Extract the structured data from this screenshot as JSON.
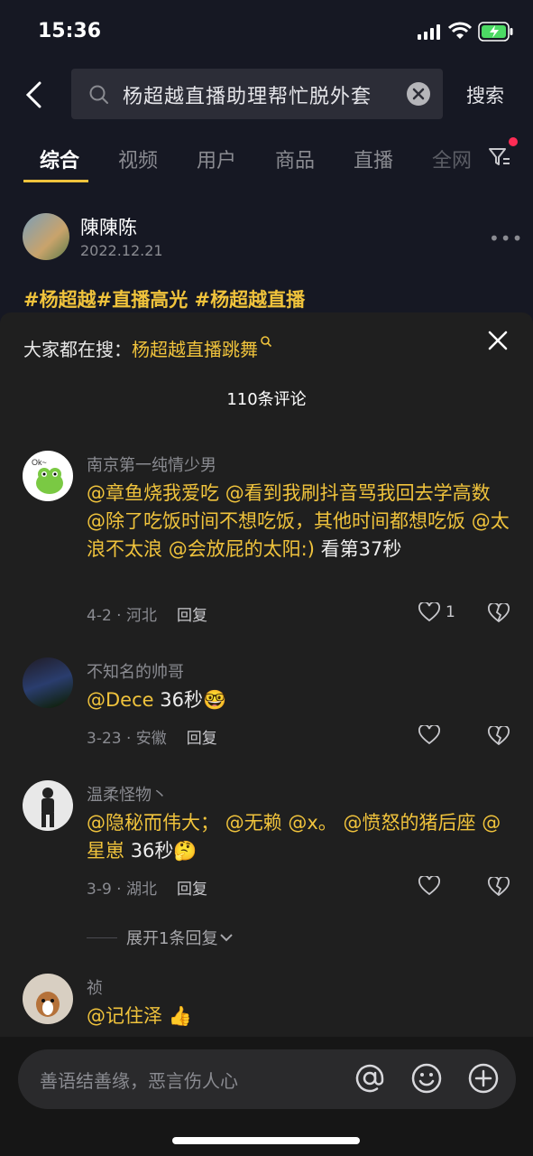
{
  "status": {
    "time": "15:36"
  },
  "search": {
    "query": "杨超越直播助理帮忙脱外套",
    "button": "搜索"
  },
  "tabs": [
    "综合",
    "视频",
    "用户",
    "商品",
    "直播",
    "全网"
  ],
  "post": {
    "author": "陳陳陈",
    "date": "2022.12.21",
    "tags": "#杨超越#直播高光  #杨超越直播"
  },
  "comments_panel": {
    "hot_label": "大家都在搜：",
    "hot_keyword": "杨超越直播跳舞",
    "count": "110条评论",
    "expand": "展开1条回复",
    "items": [
      {
        "name": "南京第一纯情少男",
        "mentions": [
          "@章鱼烧我爱吃",
          "@看到我刷抖音骂我回去学高数",
          "@除了吃饭时间不想吃饭，其他时间都想吃饭",
          "@太浪不太浪",
          "@会放屁的太阳:)"
        ],
        "text_tail": "看第37秒",
        "meta": "4-2 · 河北",
        "reply": "回复",
        "likes": "1"
      },
      {
        "name": "不知名的帅哥",
        "mentions": [
          "@Dece"
        ],
        "text_tail": "36秒",
        "emoji": "🤓",
        "meta": "3-23 · 安徽",
        "reply": "回复",
        "likes": ""
      },
      {
        "name": "温柔怪物丶",
        "mentions": [
          "@隐秘而伟大；",
          "@无赖",
          "@x。",
          "@愤怒的猪后座",
          "@星崽"
        ],
        "text_tail": "36秒",
        "emoji": "🤔",
        "meta": "3-9 · 湖北",
        "reply": "回复",
        "likes": ""
      },
      {
        "name": "祯",
        "mentions": [
          "@记住泽"
        ],
        "text_tail": "",
        "emoji": "👍",
        "meta": "",
        "reply": "",
        "likes": ""
      }
    ]
  },
  "input": {
    "placeholder": "善语结善缘，恶言伤人心"
  },
  "icons": [
    "back-icon",
    "search-icon",
    "clear-icon",
    "filter-icon",
    "more-icon",
    "close-icon",
    "heart-icon",
    "broken-heart-icon",
    "at-icon",
    "emoji-icon",
    "plus-icon"
  ],
  "colors": {
    "accent": "#f0c33c",
    "background": "#161823",
    "sheet": "#1f1f1f",
    "badge": "#fe2c55"
  }
}
